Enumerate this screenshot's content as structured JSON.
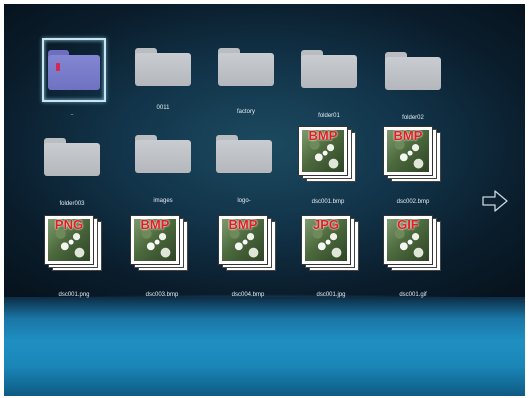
{
  "navigation": {
    "next_icon": "arrow-right-outline-icon"
  },
  "selected_index": 0,
  "items": [
    {
      "label": "..",
      "kind": "folder",
      "selected": true
    },
    {
      "label": "0011",
      "kind": "folder"
    },
    {
      "label": "factory",
      "kind": "folder"
    },
    {
      "label": "folder01",
      "kind": "folder"
    },
    {
      "label": "folder02",
      "kind": "folder"
    },
    {
      "label": "folder003",
      "kind": "folder"
    },
    {
      "label": "images",
      "kind": "folder"
    },
    {
      "label": "logo-",
      "kind": "folder"
    },
    {
      "label": "dsc001.bmp",
      "kind": "image",
      "type_badge": "BMP"
    },
    {
      "label": "dsc002.bmp",
      "kind": "image",
      "type_badge": "BMP"
    },
    {
      "label": "dsc001.png",
      "kind": "image",
      "type_badge": "PNG"
    },
    {
      "label": "dsc003.bmp",
      "kind": "image",
      "type_badge": "BMP"
    },
    {
      "label": "dsc004.bmp",
      "kind": "image",
      "type_badge": "BMP"
    },
    {
      "label": "dsc001.jpg",
      "kind": "image",
      "type_badge": "JPG"
    },
    {
      "label": "dsc001.gif",
      "kind": "image",
      "type_badge": "GIF"
    }
  ],
  "colors": {
    "background": "#0a1d2c",
    "floor": "#1f8fc2",
    "folder": "#c2c5c9",
    "selected_folder": "#7b7ecb",
    "selection_frame": "#c8e6f2",
    "label_text": "#e6eef4",
    "type_badge": "#e02020"
  }
}
